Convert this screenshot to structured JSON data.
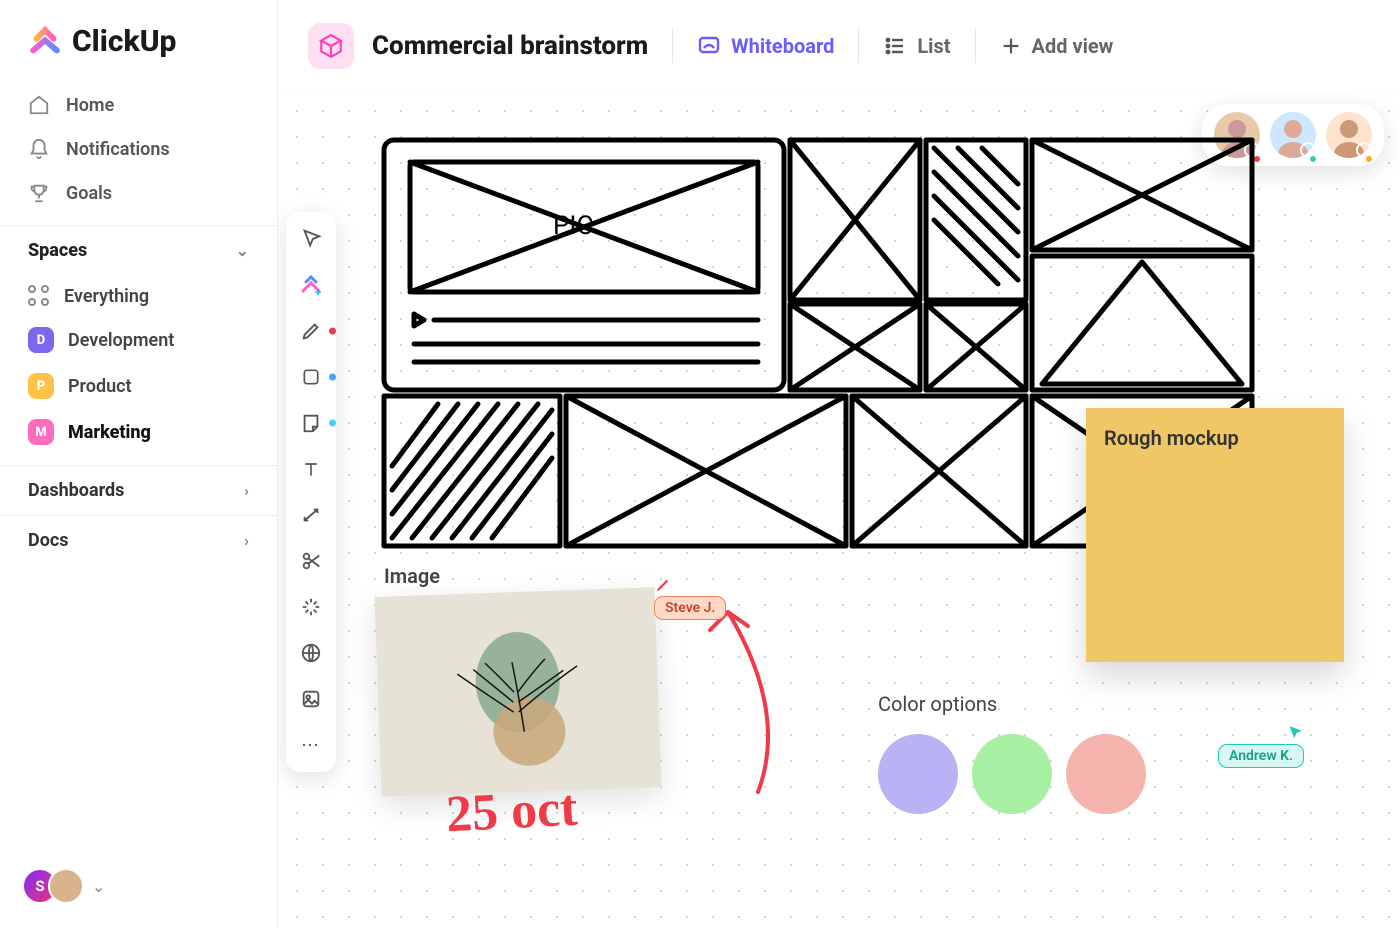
{
  "brand": "ClickUp",
  "nav": {
    "home": "Home",
    "notifications": "Notifications",
    "goals": "Goals"
  },
  "sidebar": {
    "spaces_label": "Spaces",
    "everything": "Everything",
    "spaces": [
      {
        "key": "D",
        "label": "Development",
        "color": "#7b68ee"
      },
      {
        "key": "P",
        "label": "Product",
        "color": "#ffc247"
      },
      {
        "key": "M",
        "label": "Marketing",
        "color": "#ff6bbd"
      }
    ],
    "dashboards": "Dashboards",
    "docs": "Docs"
  },
  "header": {
    "title": "Commercial brainstorm",
    "views": {
      "whiteboard": "Whiteboard",
      "list": "List",
      "add": "Add view"
    }
  },
  "canvas": {
    "image_label": "Image",
    "sketch_text": "PIC",
    "sticky": "Rough mockup",
    "handwritten": "25 oct",
    "color_options_title": "Color options",
    "colors": [
      "#b8b3f5",
      "#a6efa3",
      "#f5b3ad"
    ],
    "cursors": {
      "steve": "Steve J.",
      "andrew": "Andrew K."
    },
    "collaborator_status": [
      "#ff3b3b",
      "#25d9a1",
      "#ffa726"
    ]
  }
}
